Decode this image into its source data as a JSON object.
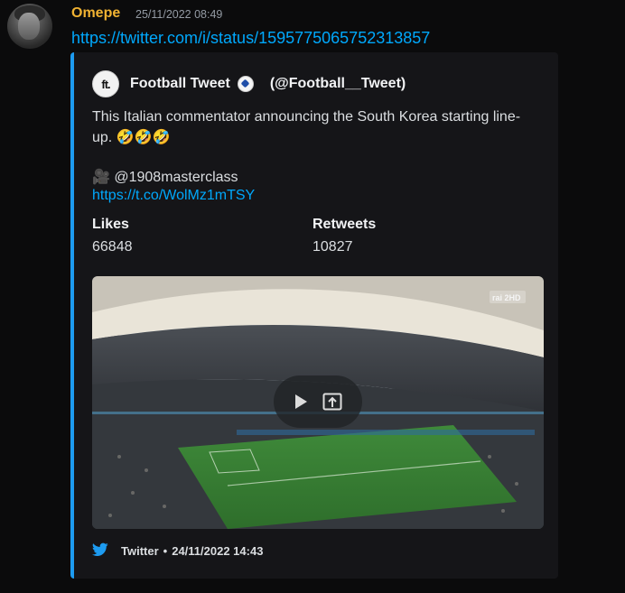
{
  "message": {
    "username": "Omepe",
    "timestamp": "25/11/2022 08:49",
    "link": "https://twitter.com/i/status/1595775065752313857"
  },
  "embed": {
    "accent_color": "#1d9bf0",
    "author_icon_text": "ft.",
    "author_name": "Football Tweet",
    "author_badge": "soccer-ball-icon",
    "author_handle": "(@Football__Tweet)",
    "description": "This Italian commentator announcing the South Korea starting line-up. 🤣🤣🤣",
    "credit": "🎥 @1908masterclass",
    "description_link": "https://t.co/WolMz1mTSY",
    "fields": [
      {
        "name": "Likes",
        "value": "66848"
      },
      {
        "name": "Retweets",
        "value": "10827"
      }
    ],
    "media": {
      "watermark": "rai 2HD",
      "play_icon": "play-icon",
      "open_icon": "open-external-icon"
    },
    "footer": {
      "source": "Twitter",
      "separator": "•",
      "date": "24/11/2022 14:43",
      "icon": "twitter-bird-icon"
    }
  }
}
